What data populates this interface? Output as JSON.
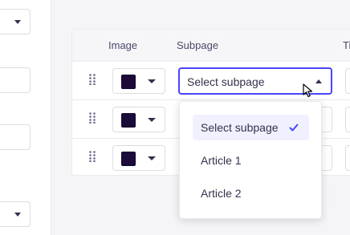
{
  "table": {
    "headers": {
      "image": "Image",
      "subpage": "Subpage",
      "next": "Ti"
    },
    "rows": [
      {
        "color": "#1c0a3a"
      },
      {
        "color": "#1c0a3a"
      },
      {
        "color": "#1c0a3a"
      }
    ]
  },
  "select": {
    "placeholder": "Select subpage",
    "options": [
      {
        "label": "Select subpage",
        "selected": true
      },
      {
        "label": "Article 1",
        "selected": false
      },
      {
        "label": "Article 2",
        "selected": false
      }
    ]
  },
  "colors": {
    "accent": "#4945ff",
    "swatch": "#1c0a3a",
    "selected_bg": "#f0f0ff"
  },
  "icons": {
    "drag": "drag-handle-icon",
    "check": "check-icon",
    "caret": "chevron-down-icon"
  }
}
